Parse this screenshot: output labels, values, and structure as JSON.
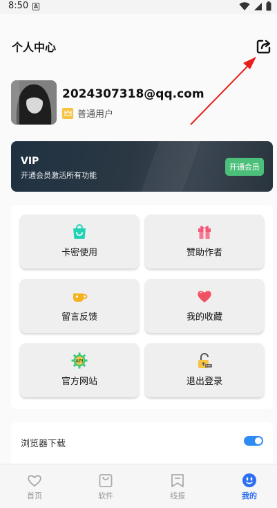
{
  "status_bar": {
    "time": "8:50",
    "a_glyph": "A"
  },
  "header": {
    "title": "个人中心"
  },
  "user": {
    "email": "2024307318@qq.com",
    "tier": "普通用户"
  },
  "vip": {
    "title": "VIP",
    "subtitle": "开通会员激活所有功能",
    "button": "开通会员"
  },
  "tiles": [
    {
      "label": "卡密使用",
      "icon": "shopping-bag-icon"
    },
    {
      "label": "赞助作者",
      "icon": "gift-icon"
    },
    {
      "label": "留言反馈",
      "icon": "coffee-cup-icon"
    },
    {
      "label": "我的收藏",
      "icon": "heart-icon"
    },
    {
      "label": "官方网站",
      "icon": "api-gear-icon"
    },
    {
      "label": "退出登录",
      "icon": "lock-icon"
    }
  ],
  "settings": {
    "browser_download": "浏览器下载",
    "browser_download_on": true
  },
  "tabbar": [
    {
      "label": "首页",
      "icon": "heart-outline-icon",
      "active": false
    },
    {
      "label": "软件",
      "icon": "bag-outline-icon",
      "active": false
    },
    {
      "label": "线报",
      "icon": "bookmark-outline-icon",
      "active": false
    },
    {
      "label": "我的",
      "icon": "smile-face-icon",
      "active": true
    }
  ],
  "colors": {
    "accent": "#2f6ff1",
    "vip_button": "#4cbf7a",
    "toggle_on": "#2f8cf5",
    "annotation_arrow": "#e8201b"
  }
}
